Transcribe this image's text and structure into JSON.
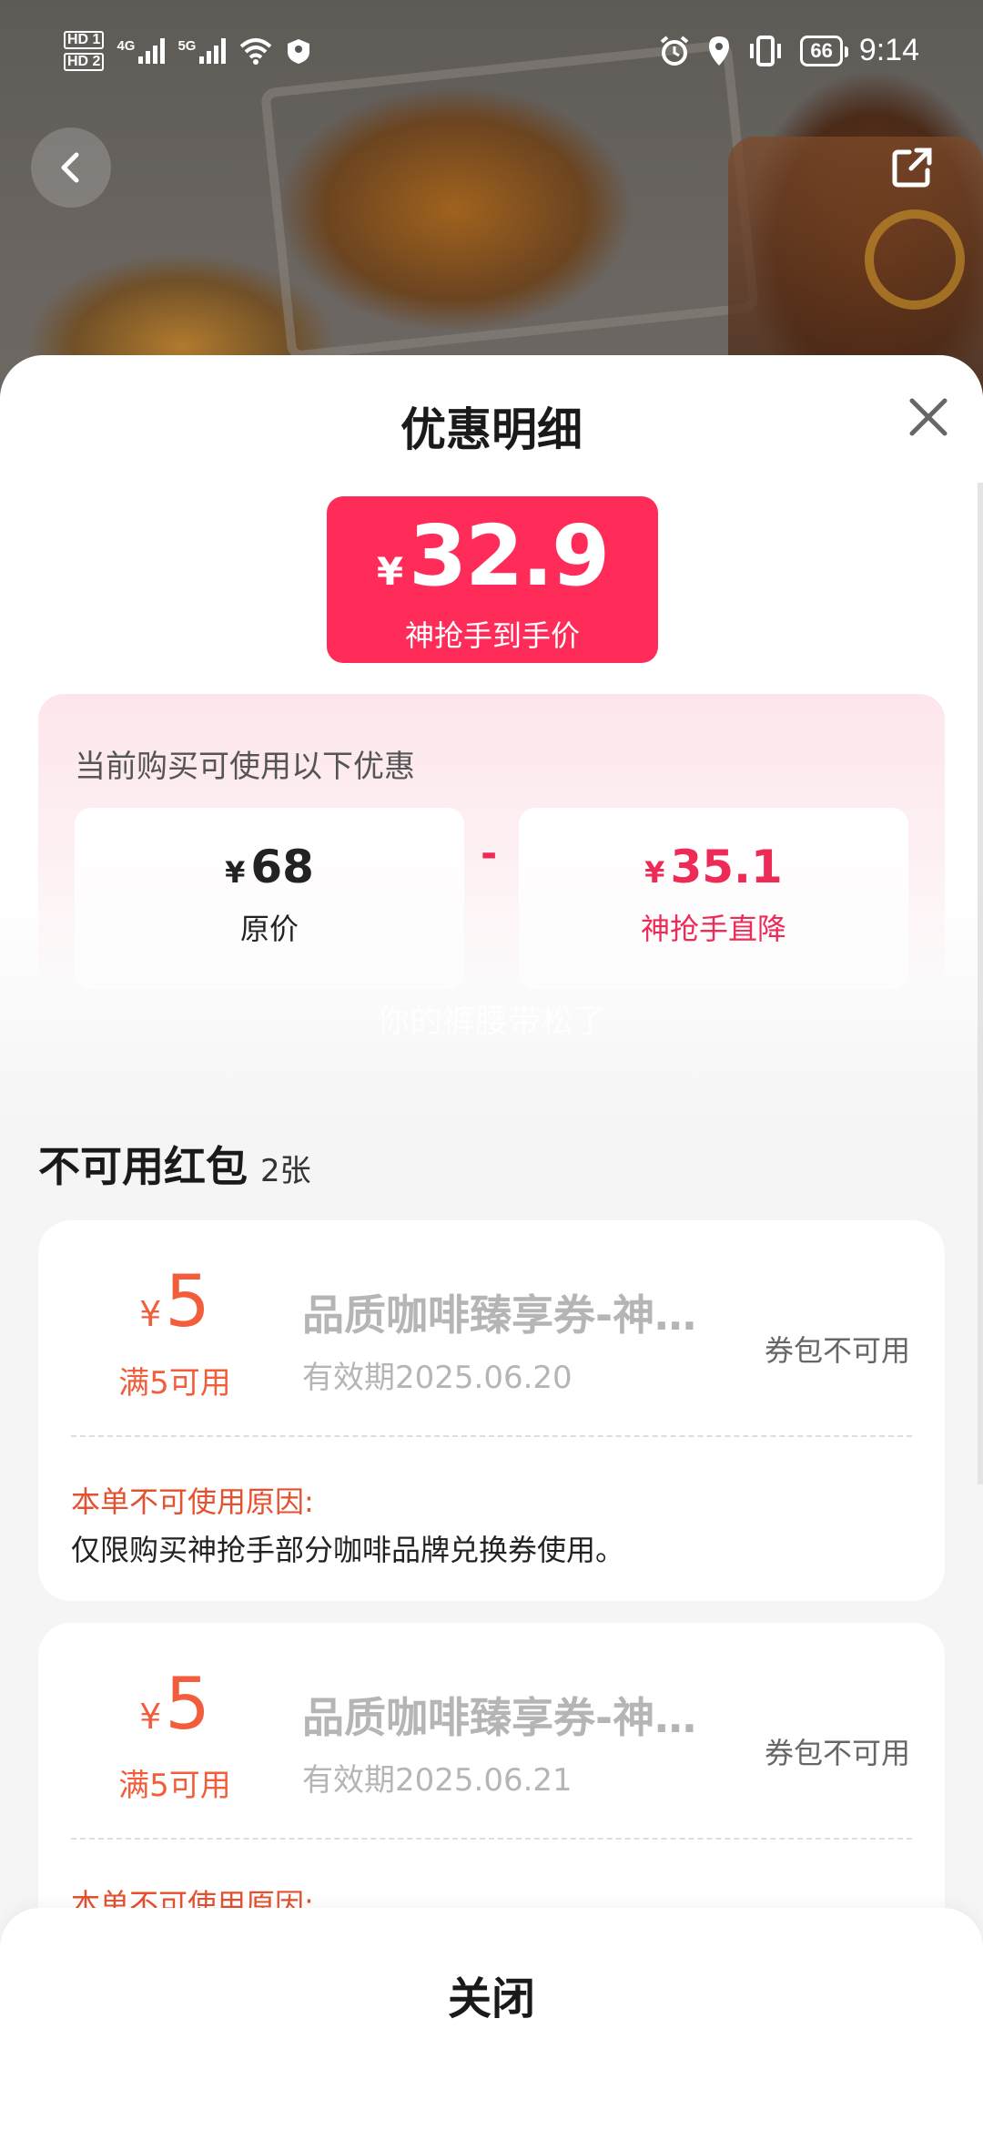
{
  "status_bar": {
    "sim1": "HD 1",
    "sim2": "HD 2",
    "net1": "4G",
    "net2": "5G",
    "battery": "66",
    "time": "9:14"
  },
  "sheet": {
    "title": "优惠明细",
    "final_price": {
      "currency": "¥",
      "value": "32.9",
      "label": "神抢手到手价"
    },
    "discount_heading": "当前购买可使用以下优惠",
    "original": {
      "currency": "¥",
      "value": "68",
      "label": "原价"
    },
    "minus": "-",
    "discount": {
      "currency": "¥",
      "value": "35.1",
      "label": "神抢手直降"
    },
    "watermark": "你的裤腰带松了",
    "unavailable": {
      "title": "不可用红包",
      "count": "2张"
    },
    "coupons": [
      {
        "currency": "¥",
        "amount": "5",
        "condition": "满5可用",
        "name": "品质咖啡臻享券-神…",
        "validity": "有效期2025.06.20",
        "status": "券包不可用",
        "reason_heading": "本单不可使用原因:",
        "reason": "仅限购买神抢手部分咖啡品牌兑换券使用。"
      },
      {
        "currency": "¥",
        "amount": "5",
        "condition": "满5可用",
        "name": "品质咖啡臻享券-神…",
        "validity": "有效期2025.06.21",
        "status": "券包不可用",
        "reason_heading": "本单不可使用原因:",
        "reason": ""
      }
    ],
    "close_label": "关闭"
  },
  "colors": {
    "accent": "#ff2c5a",
    "discount_red": "#ee2a56",
    "coupon_orange": "#f25e3c"
  },
  "icons": [
    "back-icon",
    "share-icon",
    "close-icon",
    "alarm-icon",
    "location-icon",
    "vibrate-icon",
    "wifi-icon"
  ]
}
